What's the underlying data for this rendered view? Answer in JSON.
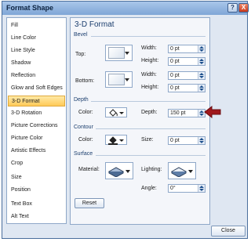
{
  "window": {
    "title": "Format Shape",
    "help_glyph": "?",
    "close_glyph": "X"
  },
  "sidebar": {
    "items": [
      {
        "label": "Fill",
        "selected": false
      },
      {
        "label": "Line Color",
        "selected": false
      },
      {
        "label": "Line Style",
        "selected": false
      },
      {
        "label": "Shadow",
        "selected": false
      },
      {
        "label": "Reflection",
        "selected": false
      },
      {
        "label": "Glow and Soft Edges",
        "selected": false
      },
      {
        "label": "3-D Format",
        "selected": true
      },
      {
        "label": "3-D Rotation",
        "selected": false
      },
      {
        "label": "Picture Corrections",
        "selected": false
      },
      {
        "label": "Picture Color",
        "selected": false
      },
      {
        "label": "Artistic Effects",
        "selected": false
      },
      {
        "label": "Crop",
        "selected": false
      },
      {
        "label": "Size",
        "selected": false
      },
      {
        "label": "Position",
        "selected": false
      },
      {
        "label": "Text Box",
        "selected": false
      },
      {
        "label": "Alt Text",
        "selected": false
      }
    ]
  },
  "panel": {
    "title": "3-D Format",
    "bevel": {
      "section": "Bevel",
      "top_label": "Top:",
      "bottom_label": "Bottom:",
      "width_label": "Width:",
      "height_label": "Height:",
      "top_width": "0 pt",
      "top_height": "0 pt",
      "bottom_width": "0 pt",
      "bottom_height": "0 pt"
    },
    "depth": {
      "section": "Depth",
      "color_label": "Color:",
      "depth_label": "Depth:",
      "depth_value": "150 pt"
    },
    "contour": {
      "section": "Contour",
      "color_label": "Color:",
      "size_label": "Size:",
      "size_value": "0 pt"
    },
    "surface": {
      "section": "Surface",
      "material_label": "Material:",
      "lighting_label": "Lighting:",
      "angle_label": "Angle:",
      "angle_value": "0°"
    },
    "reset_label": "Reset"
  },
  "footer": {
    "close_label": "Close"
  },
  "colors": {
    "accent_arrow": "#a0181c",
    "selected_item": "#ffca58"
  }
}
